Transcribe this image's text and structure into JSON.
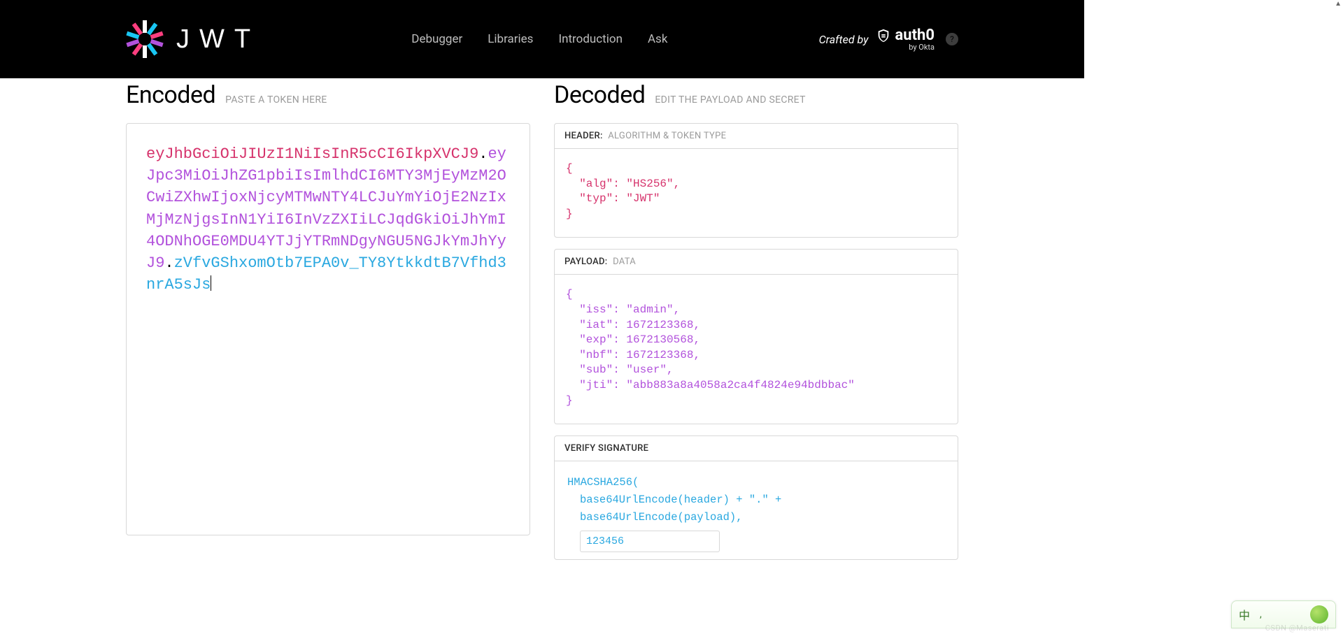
{
  "nav": {
    "items": [
      "Debugger",
      "Libraries",
      "Introduction",
      "Ask"
    ]
  },
  "crafted": {
    "label": "Crafted by",
    "brand": "auth0",
    "sub": "by Okta"
  },
  "encoded": {
    "title": "Encoded",
    "subtitle": "PASTE A TOKEN HERE",
    "token": {
      "header": "eyJhbGciOiJIUzI1NiIsInR5cCI6IkpXVCJ9",
      "payload": "eyJpc3MiOiJhZG1pbiIsImlhdCI6MTY3MjEyMzM2OCwiZXhwIjoxNjcyMTMwNTY4LCJuYmYiOjE2NzIxMjMzNjgsInN1YiI6InVzZXIiLCJqdGkiOiJhYmI4ODNhOGE0MDU4YTJjYTRmNDgyNGU5NGJkYmJhYyJ9",
      "signature": "zVfvGShxomOtb7EPA0v_TY8YtkkdtB7Vfhd3nrA5sJs"
    }
  },
  "decoded": {
    "title": "Decoded",
    "subtitle": "EDIT THE PAYLOAD AND SECRET",
    "header_card": {
      "label": "HEADER:",
      "sub": "ALGORITHM & TOKEN TYPE",
      "json": {
        "alg": "HS256",
        "typ": "JWT"
      }
    },
    "payload_card": {
      "label": "PAYLOAD:",
      "sub": "DATA",
      "json": {
        "iss": "admin",
        "iat": 1672123368,
        "exp": 1672130568,
        "nbf": 1672123368,
        "sub": "user",
        "jti": "abb883a8a4058a2ca4f4824e94bdbbac"
      }
    },
    "verify_card": {
      "label": "VERIFY SIGNATURE",
      "lines": {
        "fn": "HMACSHA256(",
        "l1": "base64UrlEncode(header) + \".\" +",
        "l2": "base64UrlEncode(payload),",
        "secret": "123456"
      }
    }
  },
  "ime": {
    "lang": "中",
    "dots": ","
  },
  "watermark": "CSDN @Maserati"
}
